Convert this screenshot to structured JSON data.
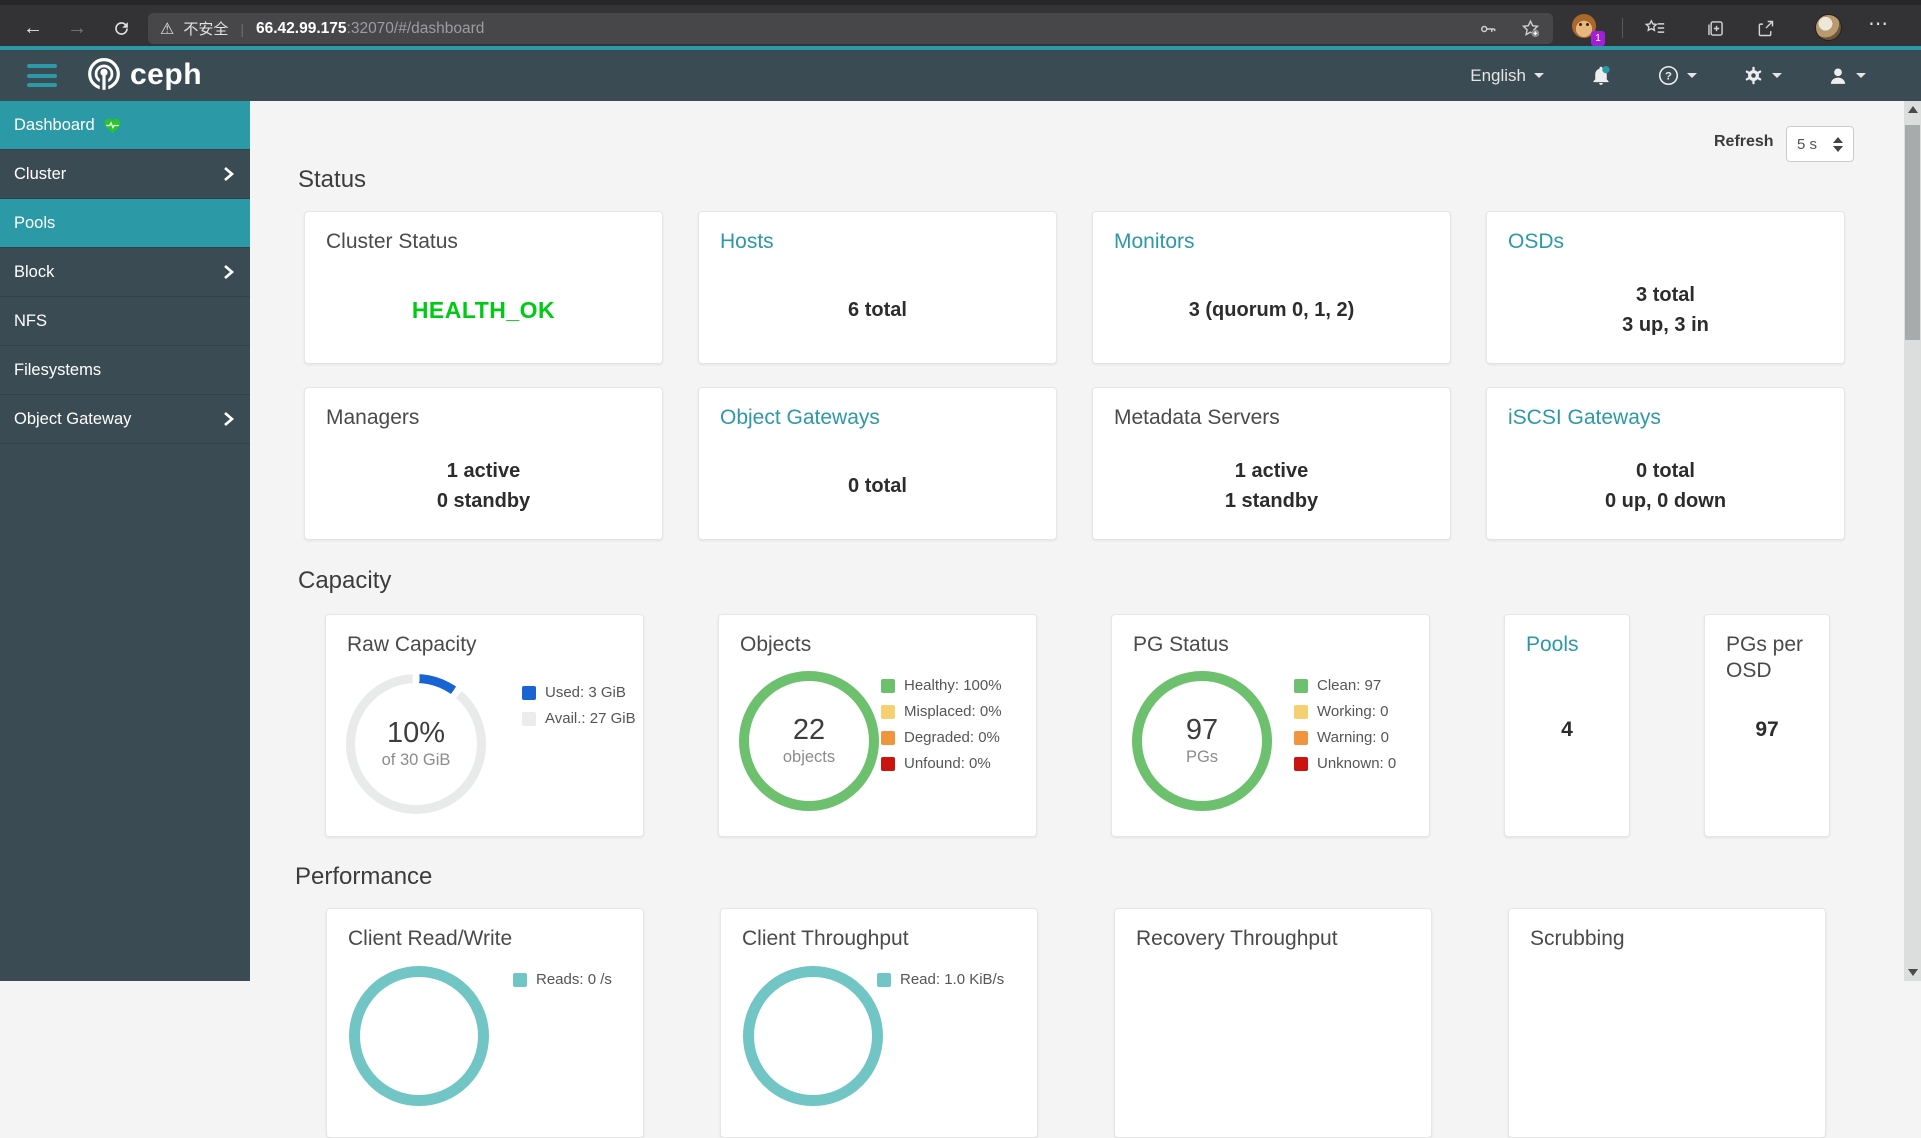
{
  "browser": {
    "security_warning": "不安全",
    "url_host": "66.42.99.175",
    "url_path": ":32070/#/dashboard",
    "extension_badge": "1",
    "menu_dots": "⋯",
    "warning_glyph": "⚠"
  },
  "navbar": {
    "brand": "ceph",
    "language": "English"
  },
  "sidebar": {
    "items": [
      {
        "label": "Dashboard"
      },
      {
        "label": "Cluster"
      },
      {
        "label": "Pools"
      },
      {
        "label": "Block"
      },
      {
        "label": "NFS"
      },
      {
        "label": "Filesystems"
      },
      {
        "label": "Object Gateway"
      }
    ]
  },
  "toolbar": {
    "refresh_label": "Refresh",
    "refresh_interval": "5 s"
  },
  "sections": {
    "status": {
      "heading": "Status",
      "cards": [
        {
          "title": "Cluster Status",
          "lines": [
            "HEALTH_OK"
          ]
        },
        {
          "title": "Hosts",
          "lines": [
            "6 total"
          ]
        },
        {
          "title": "Monitors",
          "lines": [
            "3 (quorum 0, 1, 2)"
          ]
        },
        {
          "title": "OSDs",
          "lines": [
            "3 total",
            "3 up, 3 in"
          ]
        },
        {
          "title": "Managers",
          "lines": [
            "1 active",
            "0 standby"
          ]
        },
        {
          "title": "Object Gateways",
          "lines": [
            "0 total"
          ]
        },
        {
          "title": "Metadata Servers",
          "lines": [
            "1 active",
            "1 standby"
          ]
        },
        {
          "title": "iSCSI Gateways",
          "lines": [
            "0 total",
            "0 up, 0 down"
          ]
        }
      ]
    },
    "capacity": {
      "heading": "Capacity",
      "raw": {
        "title": "Raw Capacity",
        "center_value": "10%",
        "center_sub": "of 30 GiB",
        "legend": [
          {
            "label": "Used: 3 GiB",
            "color": "#1964d2"
          },
          {
            "label": "Avail.: 27 GiB",
            "color": "#ececec"
          }
        ]
      },
      "objects": {
        "title": "Objects",
        "center_value": "22",
        "center_sub": "objects",
        "legend": [
          {
            "label": "Healthy: 100%",
            "color": "#6dc06d"
          },
          {
            "label": "Misplaced: 0%",
            "color": "#f5d071"
          },
          {
            "label": "Degraded: 0%",
            "color": "#f0953e"
          },
          {
            "label": "Unfound: 0%",
            "color": "#cb1410"
          }
        ]
      },
      "pg_status": {
        "title": "PG Status",
        "center_value": "97",
        "center_sub": "PGs",
        "legend": [
          {
            "label": "Clean: 97",
            "color": "#6dc06d"
          },
          {
            "label": "Working: 0",
            "color": "#f5d071"
          },
          {
            "label": "Warning: 0",
            "color": "#f0953e"
          },
          {
            "label": "Unknown: 0",
            "color": "#cb1410"
          }
        ]
      },
      "pools": {
        "title": "Pools",
        "value": "4"
      },
      "pgs_per_osd": {
        "title": "PGs per OSD",
        "value": "97"
      }
    },
    "performance": {
      "heading": "Performance",
      "cards": [
        {
          "title": "Client Read/Write",
          "legend": [
            {
              "label": "Reads: 0 /s",
              "color": "#72c5c5"
            }
          ]
        },
        {
          "title": "Client Throughput",
          "legend": [
            {
              "label": "Read: 1.0 KiB/s",
              "color": "#72c5c5"
            }
          ]
        },
        {
          "title": "Recovery Throughput",
          "legend": []
        },
        {
          "title": "Scrubbing",
          "legend": []
        }
      ]
    }
  },
  "colors": {
    "accent_teal": "#2b99a6",
    "link_teal": "#2b99a6",
    "health_ok_green": "#00cb14",
    "used_blue": "#1964d2",
    "healthy_green": "#6dc06d",
    "working_yellow": "#f5d071",
    "warning_orange": "#f0953e",
    "error_red": "#cb1410",
    "performance_teal": "#72c5c5"
  }
}
